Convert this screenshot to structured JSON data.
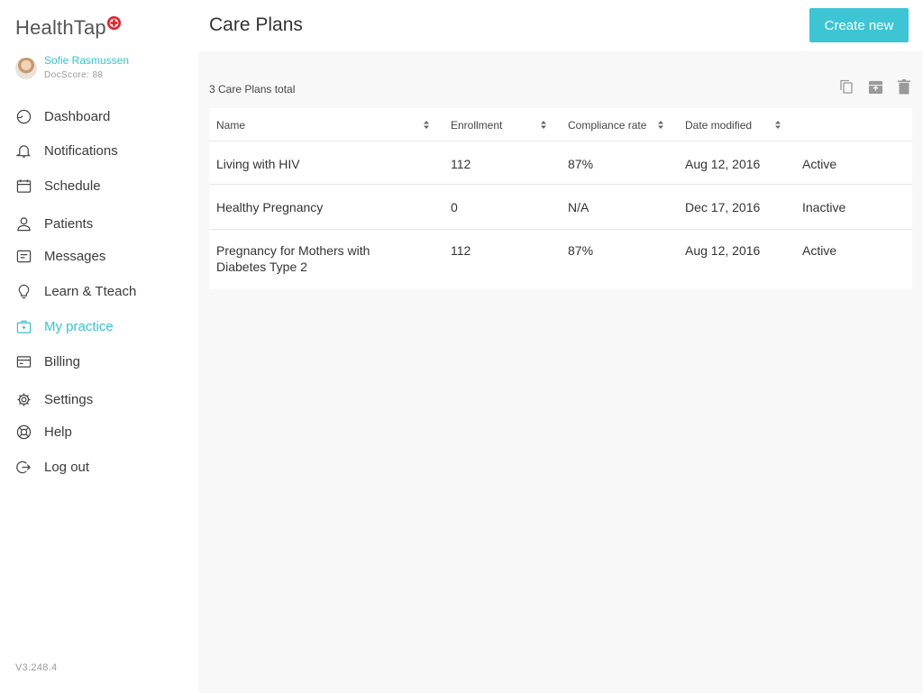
{
  "app": {
    "logo_text": "HealthTap",
    "brand_color": "#35c3cf",
    "logo_accent": "#e0242f"
  },
  "user": {
    "name": "Sofie Rasmussen",
    "score": "DocScore: 88"
  },
  "nav": [
    {
      "label": "Dashboard",
      "icon": "dashboard-icon"
    },
    {
      "label": "Notifications",
      "icon": "bell-icon"
    },
    {
      "label": "Schedule",
      "icon": "calendar-icon"
    },
    {
      "label": "Patients",
      "icon": "person-icon"
    },
    {
      "label": "Messages",
      "icon": "message-icon"
    },
    {
      "label": "Learn & Tteach",
      "icon": "lightbulb-icon"
    },
    {
      "label": "My practice",
      "icon": "briefcase-icon",
      "active": true
    },
    {
      "label": "Billing",
      "icon": "card-icon"
    },
    {
      "label": "Settings",
      "icon": "gear-icon"
    },
    {
      "label": "Help",
      "icon": "lifebuoy-icon"
    },
    {
      "label": "Log out",
      "icon": "logout-icon"
    }
  ],
  "version": "V3.248.4",
  "header": {
    "title": "Care Plans",
    "create_label": "Create new"
  },
  "list": {
    "total": "3 Care Plans total",
    "columns": [
      "Name",
      "Enrollment",
      "Compliance rate",
      "Date modified"
    ],
    "rows": [
      {
        "name": "Living with HIV",
        "enrollment": "112",
        "compliance": "87%",
        "date": "Aug 12, 2016",
        "status": "Active"
      },
      {
        "name": "Healthy Pregnancy",
        "enrollment": "0",
        "compliance": "N/A",
        "date": "Dec 17, 2016",
        "status": "Inactive"
      },
      {
        "name": "Pregnancy for Mothers with Diabetes Type 2",
        "enrollment": "112",
        "compliance": "87%",
        "date": "Aug 12, 2016",
        "status": "Active"
      }
    ]
  },
  "toolbar_icons": [
    "copy-icon",
    "archive-icon",
    "trash-icon"
  ]
}
